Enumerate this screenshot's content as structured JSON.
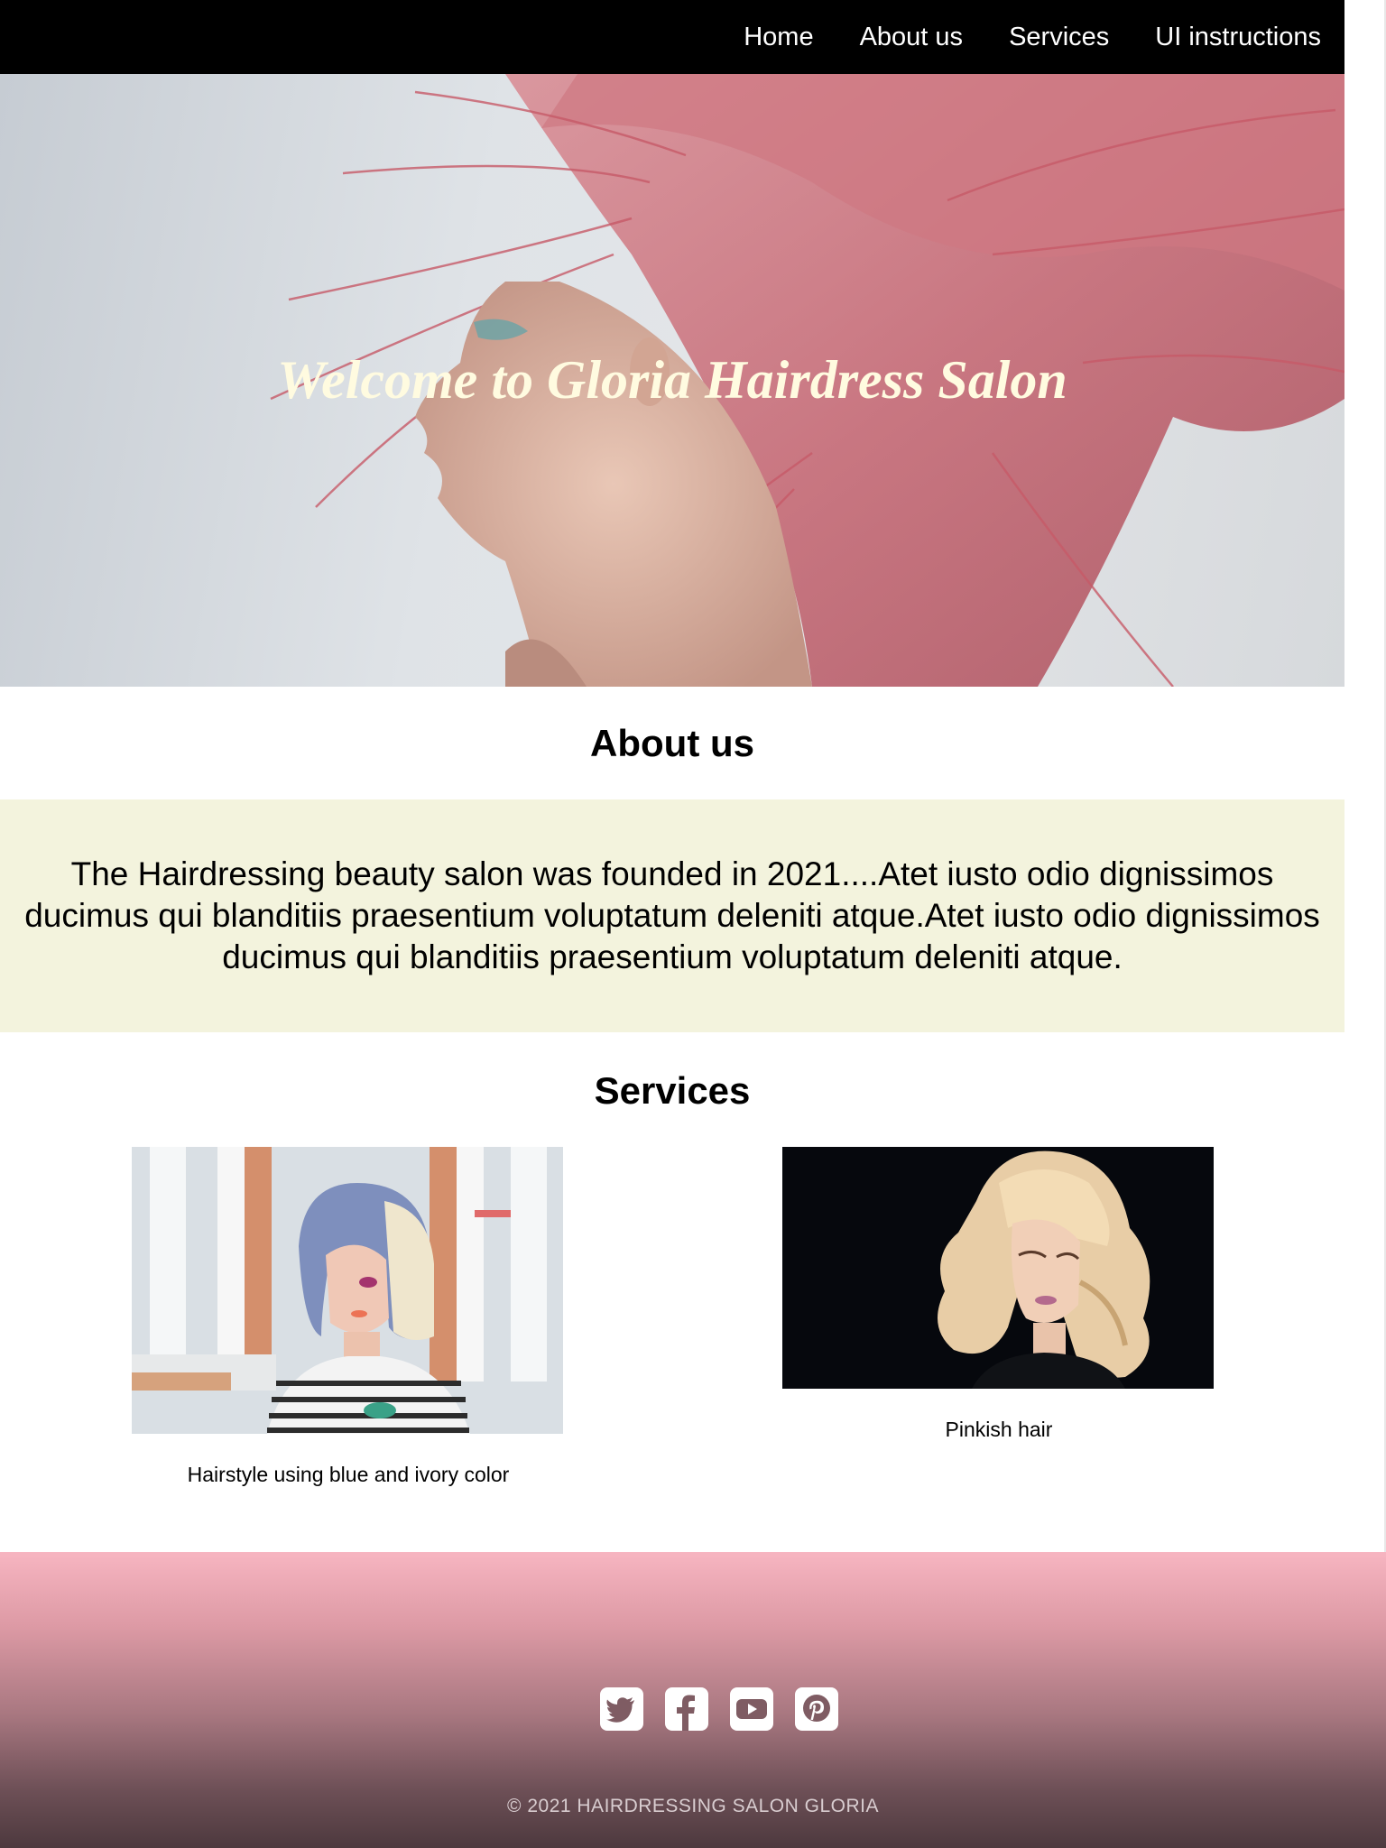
{
  "nav": {
    "items": [
      {
        "label": "Home"
      },
      {
        "label": "About us"
      },
      {
        "label": "Services"
      },
      {
        "label": "UI instructions"
      }
    ]
  },
  "hero": {
    "title": "Welcome to Gloria Hairdress Salon"
  },
  "about": {
    "heading": "About us",
    "text": "The Hairdressing beauty salon was founded in 2021....Atet iusto odio dignissimos ducimus qui blanditiis praesentium voluptatum deleniti atque.Atet iusto odio dignissimos ducimus qui blanditiis praesentium voluptatum deleniti atque."
  },
  "services": {
    "heading": "Services",
    "items": [
      {
        "caption": "Hairstyle using blue and ivory color"
      },
      {
        "caption": "Pinkish hair"
      }
    ]
  },
  "footer": {
    "social": [
      {
        "icon": "twitter-icon"
      },
      {
        "icon": "facebook-icon"
      },
      {
        "icon": "youtube-icon"
      },
      {
        "icon": "pinterest-icon"
      }
    ],
    "copyright": "© 2021 HAIRDRESSING SALON GLORIA"
  },
  "colors": {
    "nav_bg": "#000000",
    "about_band_bg": "#f3f3dd",
    "footer_top": "#f7b5c1",
    "footer_bottom": "#4d393e",
    "hero_title": "#fffbe0"
  }
}
